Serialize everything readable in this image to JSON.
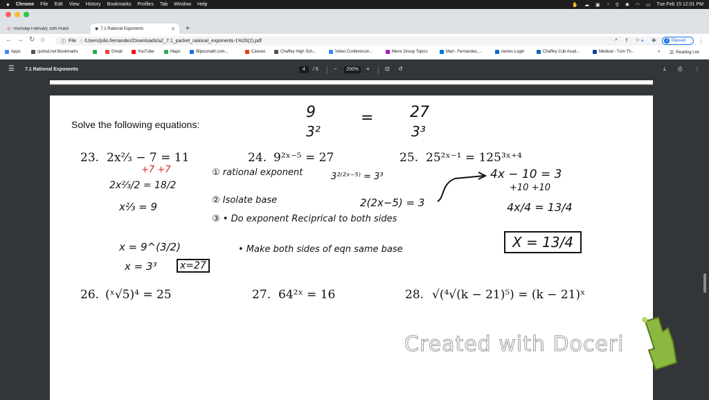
{
  "menubar": {
    "apple": "",
    "app": "Chrome",
    "items": [
      "File",
      "Edit",
      "View",
      "History",
      "Bookmarks",
      "Profiles",
      "Tab",
      "Window",
      "Help"
    ],
    "clock": "Tue Feb 15  12:01 PM"
  },
  "tabs": [
    {
      "title": "Thursday February 10th Practi",
      "active": false
    },
    {
      "title": "7.1 Rational Exponents",
      "active": true
    }
  ],
  "new_tab": "+",
  "address": {
    "prefix": "File",
    "url": "/Users/julio.fernandez/Downloads/a2_7.1_packet_rational_exponents-1%20(2).pdf"
  },
  "profile": {
    "initial": "J",
    "status": "Paused"
  },
  "bookmarks": [
    {
      "label": "Apps",
      "color": "#4285f4"
    },
    {
      "label": "cjuhsd.net Bookmarks",
      "color": "#555555"
    },
    {
      "label": "",
      "color": "#34a853"
    },
    {
      "label": "Gmail",
      "color": "#ea4335"
    },
    {
      "label": "YouTube",
      "color": "#ff0000"
    },
    {
      "label": "Maps",
      "color": "#34a853"
    },
    {
      "label": "filipocmath.com...",
      "color": "#1a73e8"
    },
    {
      "label": "Canvas",
      "color": "#e2401c"
    },
    {
      "label": "Chaffey High Sch...",
      "color": "#555555"
    },
    {
      "label": "Video Conferencin...",
      "color": "#2d8cff"
    },
    {
      "label": "Mens Group Topics",
      "color": "#9c27b0"
    },
    {
      "label": "Mail - Fernandez,...",
      "color": "#0078d4"
    },
    {
      "label": "Aeries Login",
      "color": "#1565c0"
    },
    {
      "label": "Chaffey Cub Acad...",
      "color": "#1565c0"
    },
    {
      "label": "Medical - Turn Th...",
      "color": "#0d47a1"
    }
  ],
  "bookmarks_more": "»",
  "reading_list": "Reading List",
  "pdf": {
    "title": "7.1 Rational Exponents",
    "page": "4",
    "total_pages": "/ 5",
    "zoom": "200%"
  },
  "worksheet": {
    "instruction": "Solve the following equations:",
    "problems": [
      {
        "num": "23.",
        "text": "2x⅔ − 7 = 11"
      },
      {
        "num": "24.",
        "text": "9²ˣ⁻⁵ = 27"
      },
      {
        "num": "25.",
        "text": "25²ˣ⁻¹ = 125³ˣ⁺⁴"
      },
      {
        "num": "26.",
        "text": "(ˣ√5)⁴ = 25"
      },
      {
        "num": "27.",
        "text": "64²ˣ = 16"
      },
      {
        "num": "28.",
        "text": "√(⁴√(k − 21)⁵) = (k − 21)ˣ"
      }
    ],
    "header_notes": {
      "left_top": "9",
      "left_bottom": "3²",
      "equals": "=",
      "right_top": "27",
      "right_bottom": "3³"
    },
    "steps_title": [
      "① rational exponent",
      "② Isolate base",
      "③ • Do exponent Reciprical to both sides",
      "• Make both sides of eqn same base"
    ],
    "work_23": [
      "+7   +7",
      "2x⅔/2 = 18/2",
      "x⅔ = 9",
      "x = 9^(3/2)",
      "x = 3³",
      "x=27"
    ],
    "work_24": [
      "3²⁽²ˣ⁻⁵⁾ = 3³",
      "2(2x−5) = 3"
    ],
    "work_25": [
      "4x − 10 = 3",
      "+10  +10",
      "4x/4 = 13/4",
      "X = 13/4"
    ]
  },
  "watermark": "Created with Doceri"
}
